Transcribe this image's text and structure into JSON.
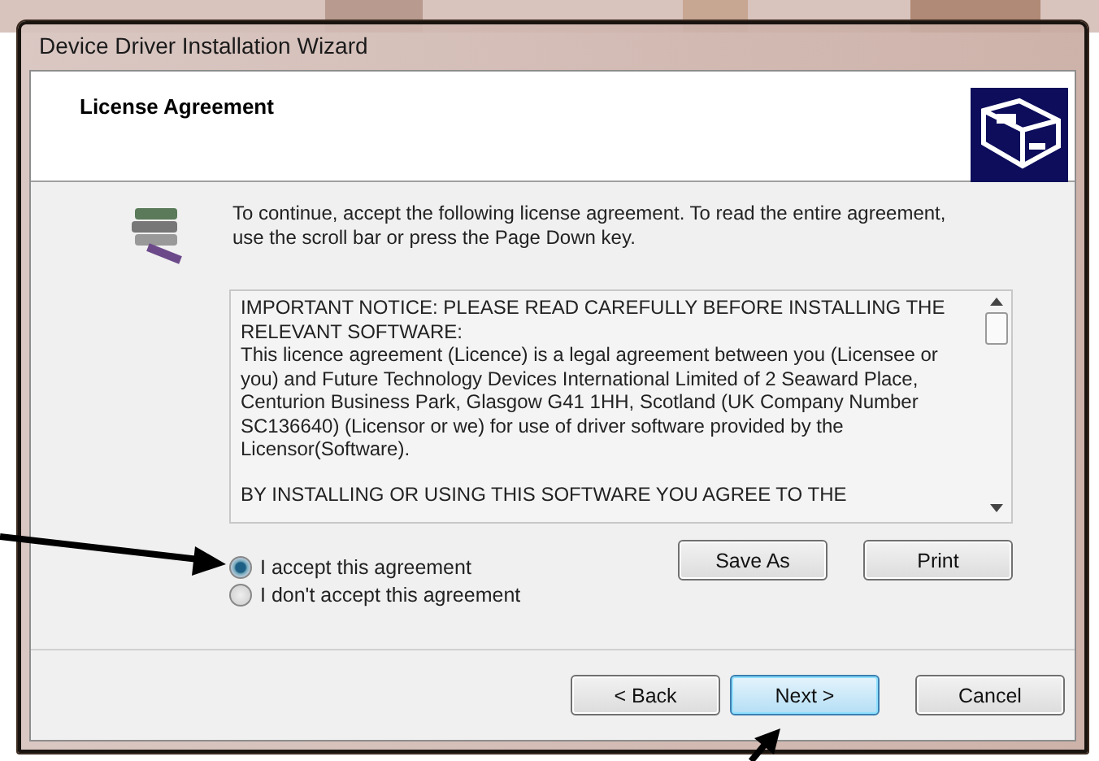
{
  "window": {
    "title": "Device Driver Installation Wizard"
  },
  "header": {
    "title": "License Agreement"
  },
  "intro": "To continue, accept the following license agreement. To read the entire agreement, use the scroll bar or press the Page Down key.",
  "license": {
    "paragraphs": [
      "IMPORTANT NOTICE: PLEASE READ CAREFULLY BEFORE INSTALLING THE RELEVANT SOFTWARE:\nThis licence agreement (Licence) is a legal agreement between you (Licensee or you) and Future Technology Devices International Limited of 2 Seaward Place, Centurion Business Park, Glasgow G41 1HH, Scotland (UK Company Number SC136640) (Licensor or we) for use of driver software provided by the Licensor(Software).",
      "BY INSTALLING OR USING THIS SOFTWARE YOU AGREE TO THE"
    ]
  },
  "options": [
    {
      "label": "I accept this agreement",
      "selected": true
    },
    {
      "label": "I don't accept this agreement",
      "selected": false
    }
  ],
  "license_buttons": [
    "Save As",
    "Print"
  ],
  "nav_buttons": [
    {
      "label": "< Back",
      "default": false
    },
    {
      "label": "Next >",
      "default": true
    },
    {
      "label": "Cancel",
      "default": false
    }
  ]
}
